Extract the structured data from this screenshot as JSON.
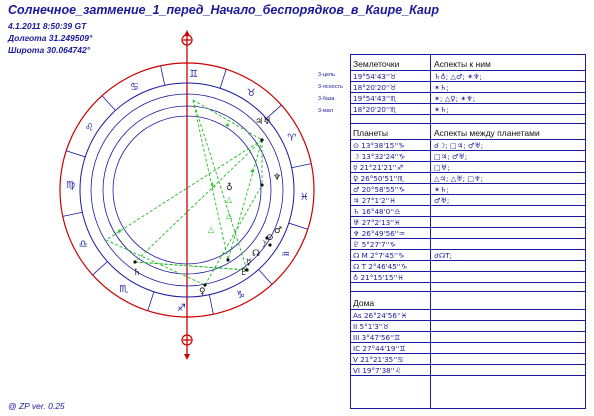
{
  "header": {
    "title": "Солнечное_затмение_1_перед_Начало_беспорядков_в_Каире_Каир",
    "datetime": "4.1.2011 8:50:39 GT",
    "longitude": "Долгота 31.249509°",
    "latitude": "Широта 30.064742°"
  },
  "footer": {
    "version": "@ ZP  ver. 0.25"
  },
  "wheel": {
    "signs": [
      "♉",
      "♈",
      "♓",
      "♒",
      "♑",
      "♐",
      "♏",
      "♎",
      "♍",
      "♌",
      "♋",
      "♊"
    ],
    "levels": [
      "3-цель",
      "3-ясность",
      "3-база",
      "3-мал"
    ],
    "planets_left": [
      "♄"
    ],
    "planets_bottom_left": [
      "♀"
    ],
    "planets_right_top": [
      "♃",
      "♅"
    ],
    "planets_right": [
      "♆"
    ],
    "planets_cluster": [
      "♂",
      "⊙",
      "☽",
      "☊",
      "☿",
      "♇",
      "♁"
    ]
  },
  "colors": {
    "accent": "#1a1aa0",
    "red_axis": "#cc0000",
    "aspect_green": "#22bb22"
  },
  "table": {
    "section1": {
      "col1": "Землеточки",
      "col2": "Аспекты к ним"
    },
    "earth_points": [
      {
        "pos": "19°54'43''♉",
        "aspects": "♄♁; △♂; ✶♆;"
      },
      {
        "pos": "18°20'20''♉",
        "aspects": "✶♄;"
      },
      {
        "pos": "19°54'43''♏",
        "aspects": "✶; △♀; ✶♆;"
      },
      {
        "pos": "18°20'20''♏",
        "aspects": "✶♄;"
      }
    ],
    "section2": {
      "col1": "Планеты",
      "col2": "Аспекты между планетами"
    },
    "planets": [
      {
        "pos": "⊙ 13°38'15''♑",
        "aspects": "☌☽; □♃; ♂♅;"
      },
      {
        "pos": "☽ 13°32'24''♑",
        "aspects": "□♃; ♂♅;"
      },
      {
        "pos": "☿ 21°21'21''♐",
        "aspects": "□♅;"
      },
      {
        "pos": "♀ 26°50'51''♏",
        "aspects": "△♃; △♅; □♆;"
      },
      {
        "pos": "♂ 20°58'55''♑",
        "aspects": "✶♄;"
      },
      {
        "pos": "♃ 27°1'2''♓",
        "aspects": "♂♅;"
      },
      {
        "pos": "♄ 16°48'0''♎",
        "aspects": ""
      },
      {
        "pos": "♅ 27°2'13''♓",
        "aspects": ""
      },
      {
        "pos": "♆ 26°49'56''♒",
        "aspects": ""
      },
      {
        "pos": "♇ 5°27'7''♑",
        "aspects": ""
      },
      {
        "pos": "☊ M 2°7'45''♑",
        "aspects": "☌☊T;"
      },
      {
        "pos": "☊ T 2°46'45''♑",
        "aspects": ""
      },
      {
        "pos": "♁ 21°15'15''♓",
        "aspects": ""
      }
    ],
    "section3": {
      "col1": "Дома"
    },
    "houses": [
      {
        "pos": "As 26°24'56''♓"
      },
      {
        "pos": "II 5°1'3''♉"
      },
      {
        "pos": "III 3°47'56''♊"
      },
      {
        "pos": "IC 27°44'19''♊"
      },
      {
        "pos": "V 21°21'35''♋"
      },
      {
        "pos": "VI 19°7'38''♌"
      }
    ]
  }
}
